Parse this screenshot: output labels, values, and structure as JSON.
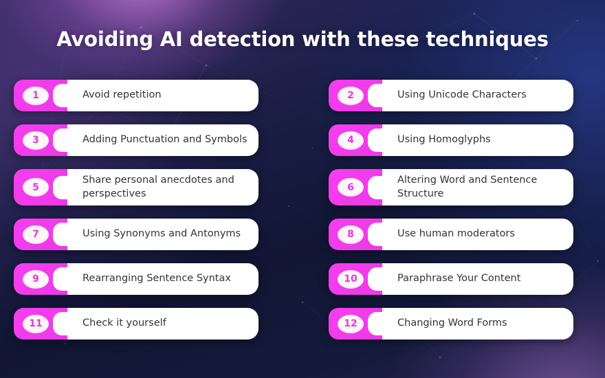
{
  "header": {
    "title": "Avoiding AI detection with these techniques"
  },
  "colors": {
    "badge_magenta": "#f23ceb",
    "badge_number_text": "#e43ad8",
    "card_background": "#ffffff",
    "card_text": "#333338",
    "title_text": "#ffffff",
    "background_purple": "#3a2a63",
    "background_navy": "#121634",
    "background_blue": "#263860"
  },
  "columns": {
    "left": [
      {
        "number": "1",
        "label": "Avoid repetition"
      },
      {
        "number": "3",
        "label": "Adding Punctuation and Symbols"
      },
      {
        "number": "5",
        "label": "Share personal anecdotes and perspectives"
      },
      {
        "number": "7",
        "label": "Using Synonyms and Antonyms"
      },
      {
        "number": "9",
        "label": "Rearranging Sentence Syntax"
      },
      {
        "number": "11",
        "label": "Check it yourself"
      }
    ],
    "right": [
      {
        "number": "2",
        "label": "Using Unicode Characters"
      },
      {
        "number": "4",
        "label": "Using Homoglyphs"
      },
      {
        "number": "6",
        "label": "Altering Word and Sentence Structure"
      },
      {
        "number": "8",
        "label": "Use human moderators"
      },
      {
        "number": "10",
        "label": "Paraphrase Your Content"
      },
      {
        "number": "12",
        "label": "Changing Word Forms"
      }
    ]
  }
}
